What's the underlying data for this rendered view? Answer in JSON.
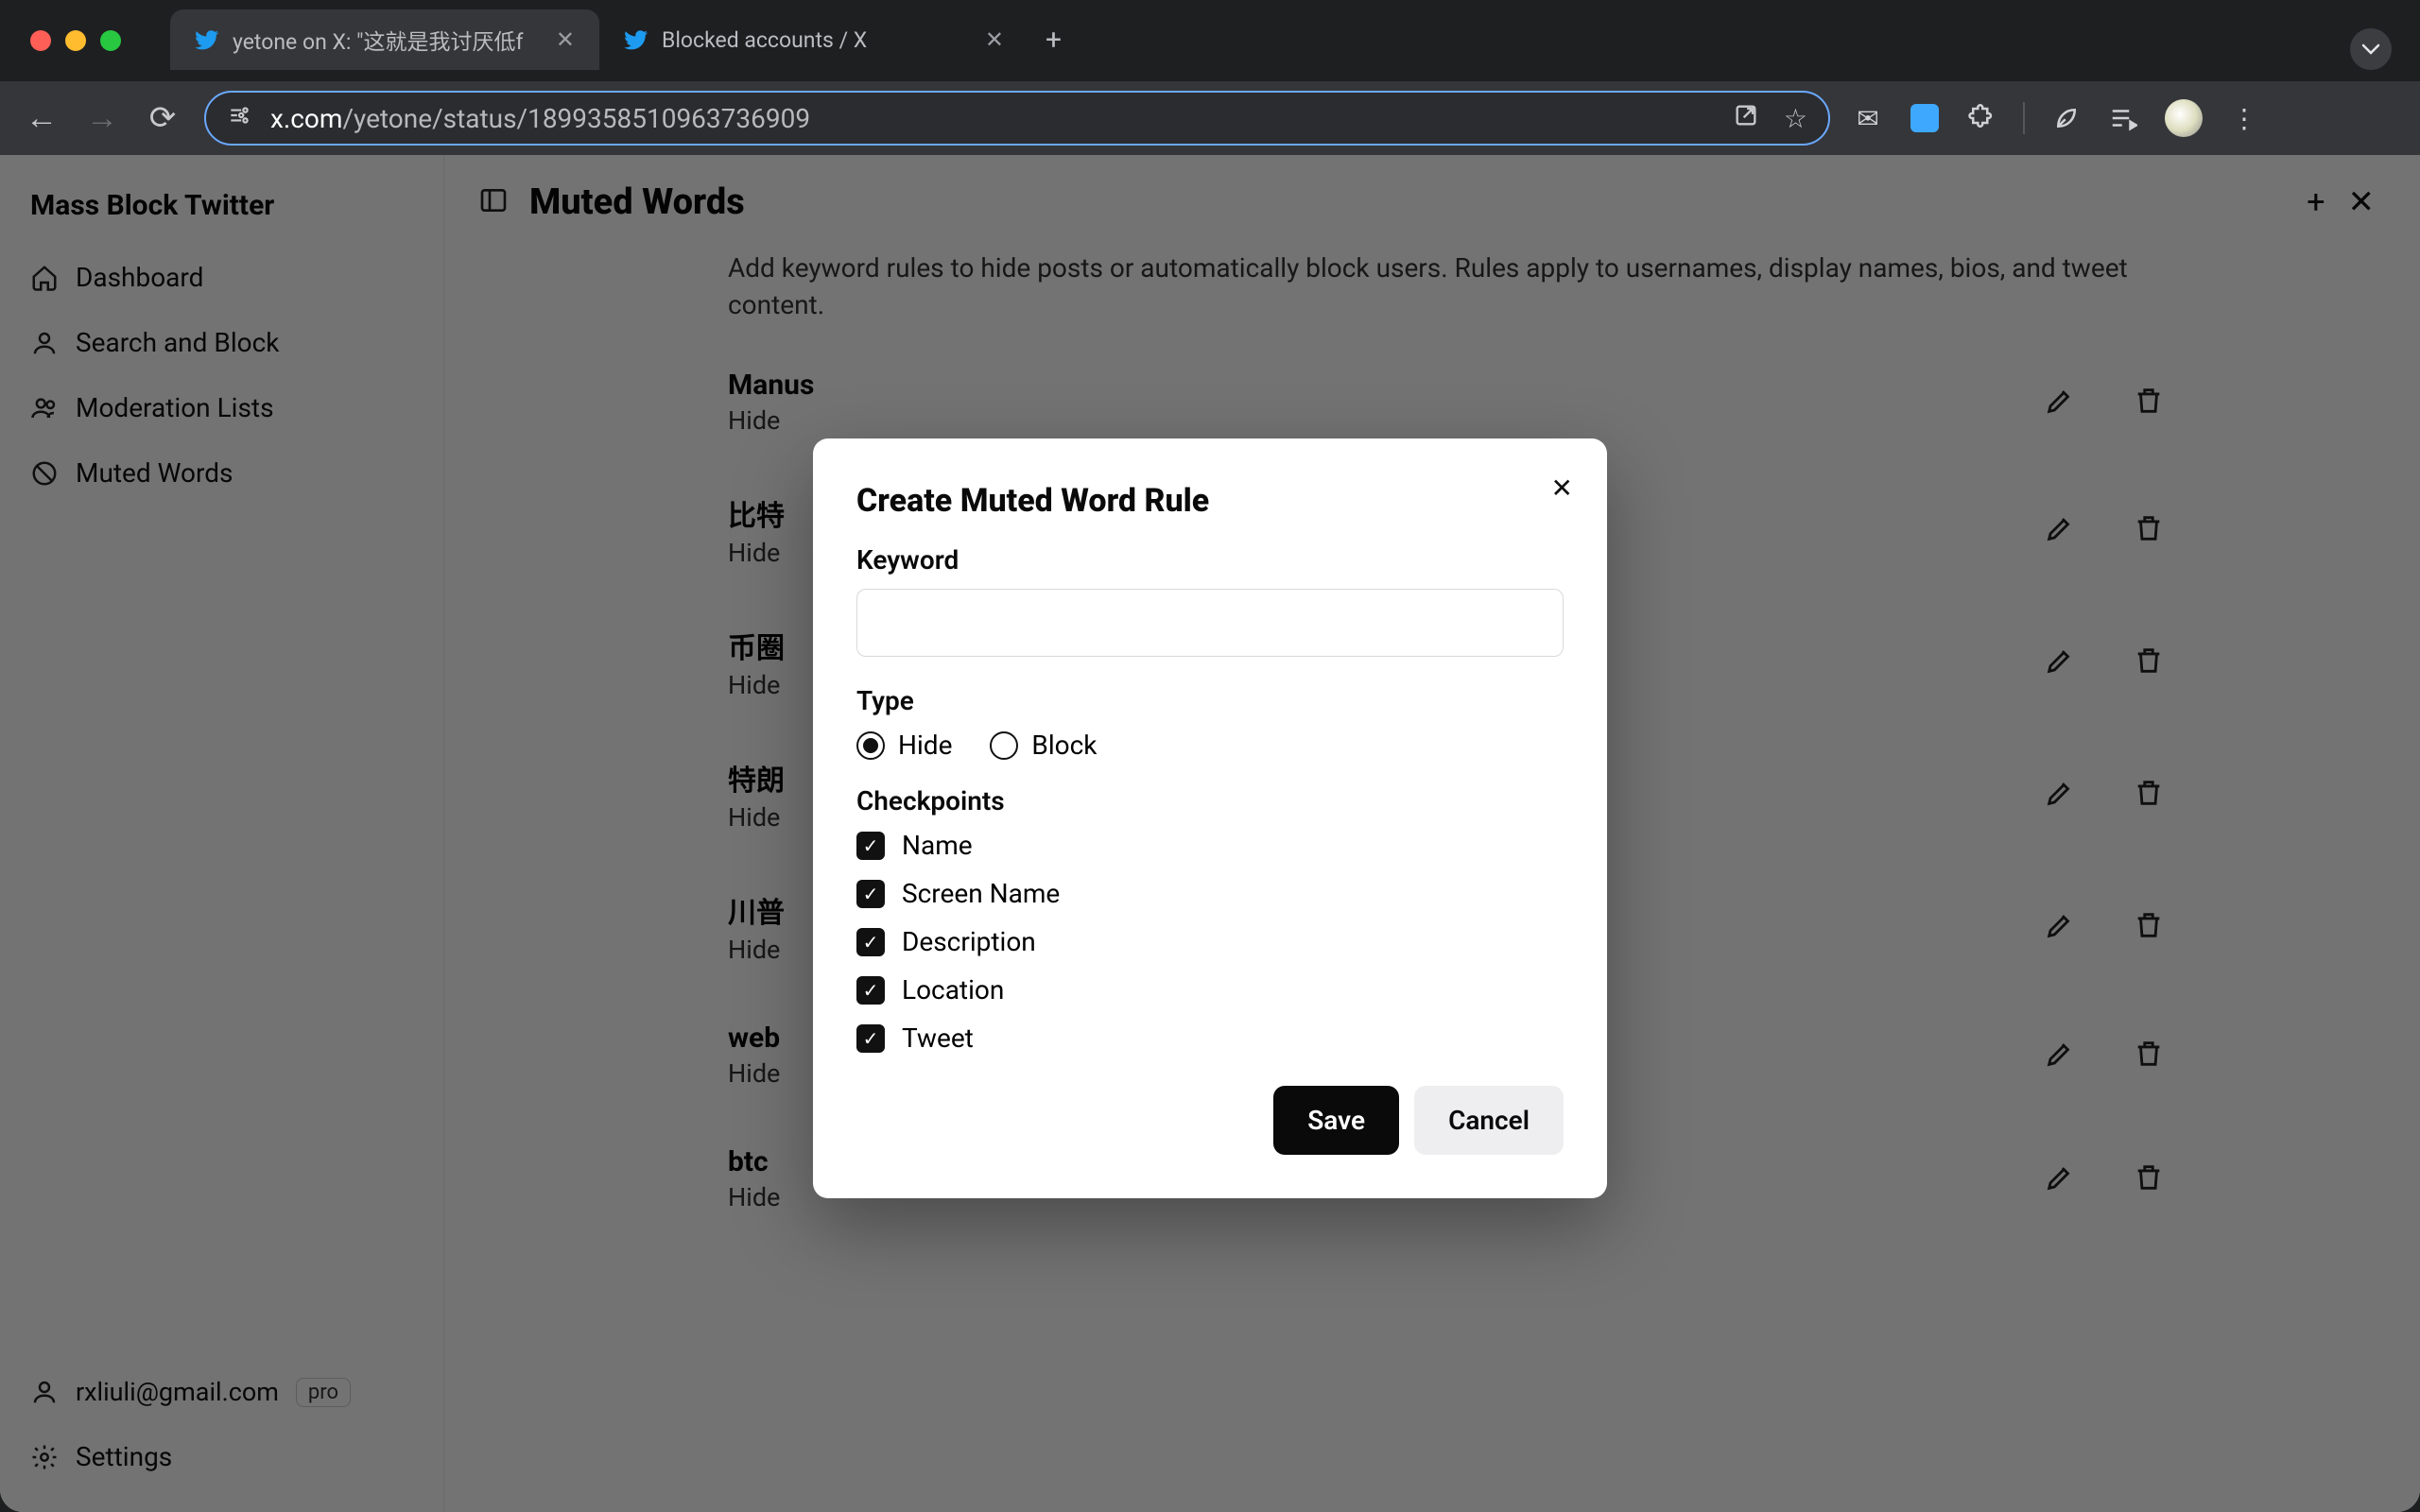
{
  "browser": {
    "tabs": [
      {
        "title": "yetone on X: \"这就是我讨厌低f",
        "active": true
      },
      {
        "title": "Blocked accounts / X",
        "active": false
      }
    ],
    "url_domain": "x.com",
    "url_path": "/yetone/status/1899358510963736909"
  },
  "sidebar": {
    "title": "Mass Block Twitter",
    "items": [
      {
        "label": "Dashboard"
      },
      {
        "label": "Search and Block"
      },
      {
        "label": "Moderation Lists"
      },
      {
        "label": "Muted Words"
      }
    ],
    "user_email": "rxliuli@gmail.com",
    "pro_badge": "pro",
    "settings_label": "Settings"
  },
  "main": {
    "title": "Muted Words",
    "subtitle": "Add keyword rules to hide posts or automatically block users. Rules apply to usernames, display names, bios, and tweet content.",
    "rules": [
      {
        "keyword": "Manus",
        "action": "Hide"
      },
      {
        "keyword": "比特",
        "action": "Hide"
      },
      {
        "keyword": "币圈",
        "action": "Hide"
      },
      {
        "keyword": "特朗",
        "action": "Hide"
      },
      {
        "keyword": "川普",
        "action": "Hide"
      },
      {
        "keyword": "web",
        "action": "Hide"
      },
      {
        "keyword": "btc",
        "action": "Hide"
      }
    ]
  },
  "modal": {
    "title": "Create Muted Word Rule",
    "keyword_label": "Keyword",
    "keyword_value": "",
    "type_label": "Type",
    "type_options": {
      "hide": "Hide",
      "block": "Block"
    },
    "type_selected": "hide",
    "checkpoints_label": "Checkpoints",
    "checkpoints": [
      {
        "label": "Name",
        "checked": true
      },
      {
        "label": "Screen Name",
        "checked": true
      },
      {
        "label": "Description",
        "checked": true
      },
      {
        "label": "Location",
        "checked": true
      },
      {
        "label": "Tweet",
        "checked": true
      }
    ],
    "save_label": "Save",
    "cancel_label": "Cancel"
  }
}
